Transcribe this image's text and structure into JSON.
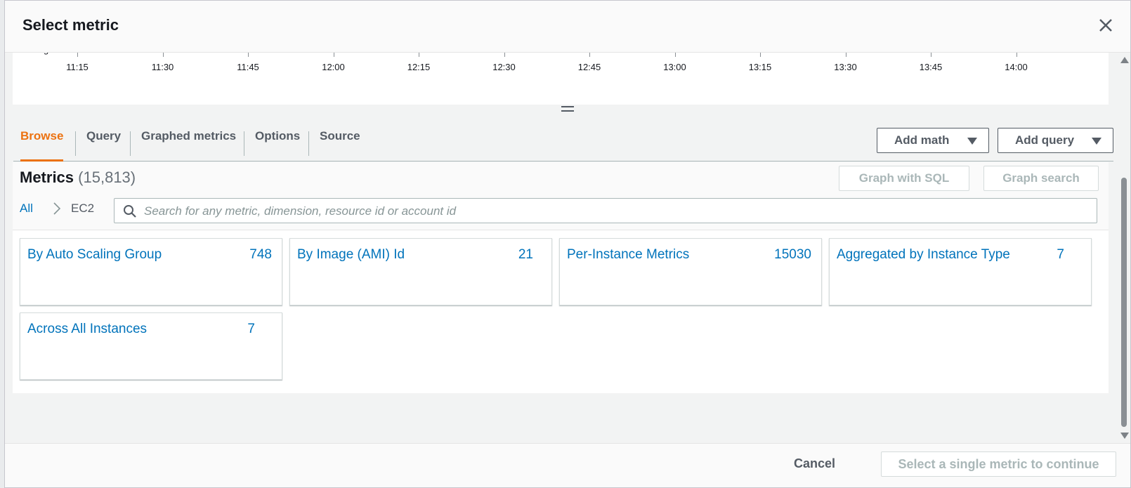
{
  "modal": {
    "title": "Select metric"
  },
  "time_axis": {
    "labels": [
      "11:15",
      "11:30",
      "11:45",
      "12:00",
      "12:15",
      "12:30",
      "12:45",
      "13:00",
      "13:15",
      "13:30",
      "13:45",
      "14:00"
    ]
  },
  "tabs": [
    {
      "label": "Browse",
      "active": true
    },
    {
      "label": "Query",
      "active": false
    },
    {
      "label": "Graphed metrics",
      "active": false
    },
    {
      "label": "Options",
      "active": false
    },
    {
      "label": "Source",
      "active": false
    }
  ],
  "actions": {
    "add_math": "Add math",
    "add_query": "Add query",
    "graph_with_sql": "Graph with SQL",
    "graph_search": "Graph search"
  },
  "metrics": {
    "title": "Metrics",
    "count": "(15,813)",
    "breadcrumb": {
      "all": "All",
      "current": "EC2"
    },
    "search_placeholder": "Search for any metric, dimension, resource id or account id",
    "cards": [
      {
        "label": "By Auto Scaling Group",
        "count": "748"
      },
      {
        "label": "By Image (AMI) Id",
        "count": "21"
      },
      {
        "label": "Per-Instance Metrics",
        "count": "15030"
      },
      {
        "label": "Aggregated by Instance Type",
        "count": "7"
      },
      {
        "label": "Across All Instances",
        "count": "7"
      }
    ]
  },
  "footer": {
    "cancel": "Cancel",
    "continue": "Select a single metric to continue"
  },
  "colors": {
    "accent": "#ec7211",
    "link": "#0073bb"
  }
}
